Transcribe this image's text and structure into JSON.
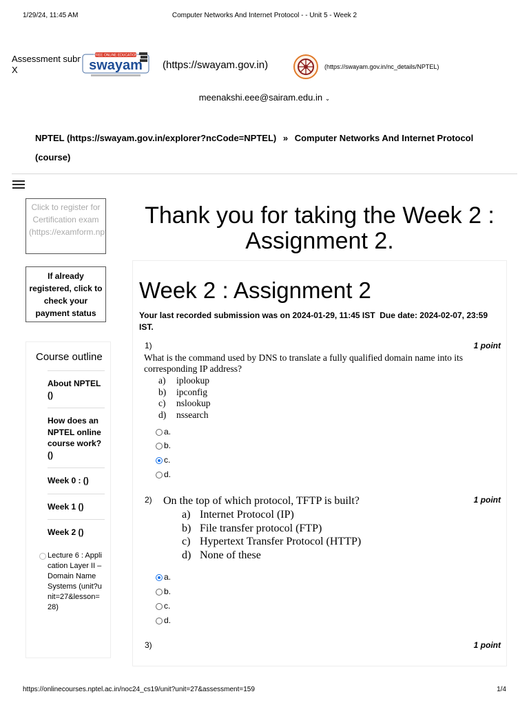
{
  "print": {
    "datetime": "1/29/24, 11:45 AM",
    "title": "Computer Networks And Internet Protocol - - Unit 5 - Week 2",
    "footer_url": "https://onlinecourses.nptel.ac.in/noc24_cs19/unit?unit=27&assessment=159",
    "page": "1/4"
  },
  "header": {
    "assessment_line1": "Assessment submitted.",
    "assessment_line2": "X",
    "swayam_link": "(https://swayam.gov.in)",
    "nptel_link": "(https://swayam.gov.in/nc_details/NPTEL)",
    "user_email": "meenakshi.eee@sairam.edu.in"
  },
  "breadcrumb": {
    "root": "NPTEL (https://swayam.gov.in/explorer?ncCode=NPTEL)",
    "separator": "»",
    "course": "Computer Networks And Internet Protocol (course)"
  },
  "sidebar": {
    "register_button": "Click to register for Certification exam (https://examform.nptel.ac.in/2024_01/exam_form/dashboard)",
    "payment_button": "If already registered, click to check your payment status",
    "outline_title": "Course outline",
    "items": [
      "About NPTEL ()",
      "How does an NPTEL online course work? ()",
      "Week 0 : ()",
      "Week 1 ()",
      "Week 2 ()"
    ],
    "sub_item": "Lecture 6 : Application Layer II – Domain Name Systems (unit?unit=27&lesson=28)"
  },
  "main": {
    "thanks": "Thank you for taking the Week 2 : Assignment 2.",
    "title": "Week 2 : Assignment 2",
    "submission_text": "Your last recorded submission was on 2024-01-29, 11:45 IST",
    "due_text": "Due date: 2024-02-07, 23:59 IST.",
    "questions": [
      {
        "number": "1)",
        "points": "1 point",
        "text": "What is the command used by DNS to translate a fully qualified domain name into its corresponding IP address?",
        "options": [
          {
            "letter": "a)",
            "text": "iplookup"
          },
          {
            "letter": "b)",
            "text": "ipconfig"
          },
          {
            "letter": "c)",
            "text": "nslookup"
          },
          {
            "letter": "d)",
            "text": "nssearch"
          }
        ],
        "radios": [
          "a.",
          "b.",
          "c.",
          "d."
        ],
        "selected": 2
      },
      {
        "number": "2)",
        "points": "1 point",
        "text": "On the top of which protocol, TFTP is built?",
        "options": [
          {
            "letter": "a)",
            "text": "Internet Protocol (IP)"
          },
          {
            "letter": "b)",
            "text": "File transfer protocol (FTP)"
          },
          {
            "letter": "c)",
            "text": "Hypertext Transfer Protocol (HTTP)"
          },
          {
            "letter": "d)",
            "text": "None of these"
          }
        ],
        "radios": [
          "a.",
          "b.",
          "c.",
          "d."
        ],
        "selected": 0
      },
      {
        "number": "3)",
        "points": "1 point"
      }
    ]
  }
}
